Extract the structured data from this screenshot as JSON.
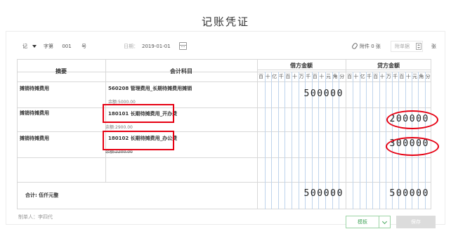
{
  "title": "记账凭证",
  "toolbar": {
    "voucher_type": "记",
    "zi_label": "字第",
    "number": "001",
    "hao_label": "号",
    "date_label": "日期：",
    "date_value": "2019-01-01",
    "attachment_label": "附件 0 张",
    "attach_placeholder": "附单据",
    "zhang_label": "张"
  },
  "table": {
    "headers": {
      "summary": "摘要",
      "account": "会计科目",
      "debit": "借方金额",
      "credit": "贷方金额"
    },
    "digit_units": [
      "百",
      "十",
      "亿",
      "千",
      "百",
      "十",
      "万",
      "千",
      "百",
      "十",
      "元",
      "角",
      "分"
    ],
    "rows": [
      {
        "summary": "摊销待摊费用",
        "account": "560208 管理费用_长期待摊费用摊销",
        "balance": "余额:5000.00",
        "debit": "500000",
        "credit": ""
      },
      {
        "summary": "摊销待摊费用",
        "account": "180101 长期待摊费用_开办费",
        "balance": "余额:2900.00",
        "debit": "",
        "credit": "200000"
      },
      {
        "summary": "摊销待摊费用",
        "account": "180102 长期待摊费用_办公费",
        "balance": "余额:2200.00",
        "debit": "",
        "credit": "300000"
      }
    ],
    "total": {
      "label": "合计:  伍仟元整",
      "debit": "500000",
      "credit": "500000"
    }
  },
  "footer": {
    "maker": "制单人：李四代",
    "template_button": "模板",
    "save_button": "保存"
  },
  "colors": {
    "annotation_red": "#e60012",
    "accent_green": "#4aa860",
    "digit_line_blue": "#bfd4ec"
  },
  "icons": [
    "caret-down-icon",
    "calendar-icon",
    "paperclip-icon",
    "spinner-icon",
    "chevron-down-icon"
  ]
}
